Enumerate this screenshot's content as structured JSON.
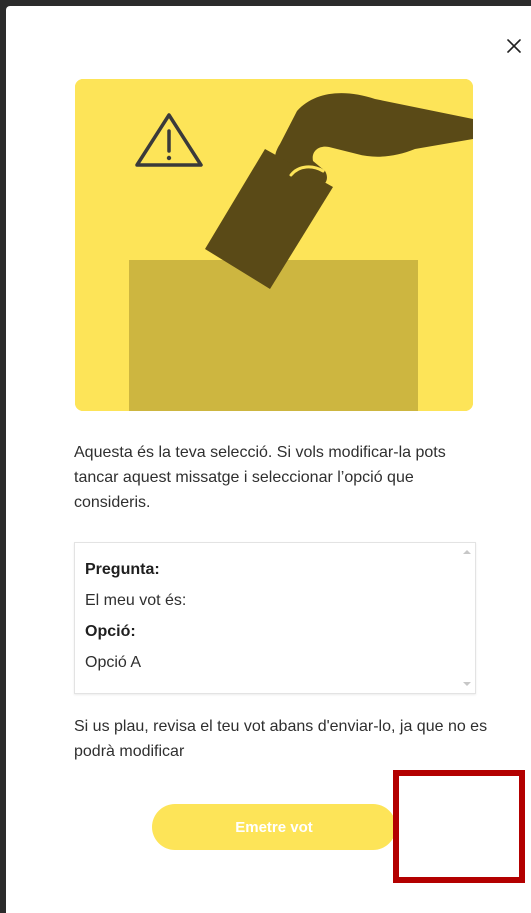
{
  "dialog": {
    "close_icon": "close-icon",
    "intro_text": "Aquesta és la teva selecció. Si vols modificar-la pots tancar aquest missatge i seleccionar l’opció que consideris.",
    "summary": {
      "question_label": "Pregunta:",
      "question_value": "El meu vot és:",
      "option_label": "Opció:",
      "option_value": "Opció A"
    },
    "warning_text": "Si us plau, revisa el teu vot abans d'enviar-lo, ja que no es podrà modificar",
    "submit_label": "Emetre vot"
  },
  "colors": {
    "accent_yellow": "#fde458",
    "illustration_dark": "#5a4a17",
    "ballot_box": "#cdb640",
    "highlight_red": "#b30000"
  }
}
